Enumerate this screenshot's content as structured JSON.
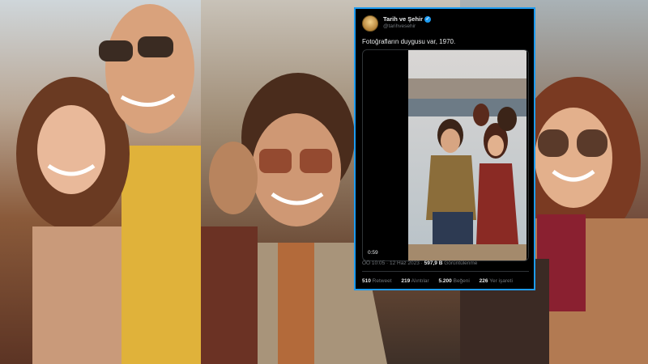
{
  "tweet": {
    "display_name": "Tarih ve Şehir",
    "handle": "@tarihvesehir",
    "text": "Fotoğrafların duygusu var, 1970.",
    "video_duration": "0:59",
    "time": "ÖÖ 10:05",
    "date": "12 Haz 2023",
    "views_value": "597,9 B",
    "views_label": "Görüntülenme",
    "retweets_value": "510",
    "retweets_label": "Retweet",
    "quotes_value": "219",
    "quotes_label": "Alıntılar",
    "likes_value": "5.200",
    "likes_label": "Beğeni",
    "bookmarks_value": "226",
    "bookmarks_label": "Yer işareti"
  },
  "colors": {
    "accent": "#1d9bf0",
    "tweet_bg": "#000000",
    "muted": "#71767b",
    "text": "#e7e9ea"
  }
}
